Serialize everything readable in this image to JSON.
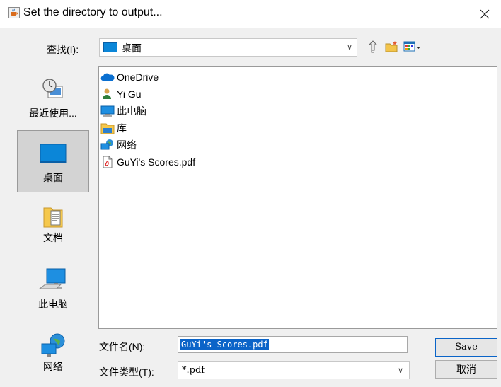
{
  "window": {
    "title": "Set the directory to output...",
    "title_icon": "java-cup-icon",
    "close_icon": "close-icon"
  },
  "lookin": {
    "label": "查找(I):",
    "value": "桌面",
    "value_icon": "desktop-icon",
    "toolbar": [
      "up-one-level-icon",
      "new-folder-icon",
      "view-menu-icon"
    ]
  },
  "sidebar": {
    "items": [
      {
        "label": "最近使用...",
        "icon": "recent-items-icon",
        "selected": false
      },
      {
        "label": "桌面",
        "icon": "desktop-icon",
        "selected": true
      },
      {
        "label": "文档",
        "icon": "documents-icon",
        "selected": false
      },
      {
        "label": "此电脑",
        "icon": "computer-icon",
        "selected": false
      },
      {
        "label": "网络",
        "icon": "network-icon",
        "selected": false
      }
    ]
  },
  "files": [
    {
      "name": "OneDrive",
      "icon": "onedrive-icon"
    },
    {
      "name": "Yi Gu",
      "icon": "user-icon"
    },
    {
      "name": "此电脑",
      "icon": "computer-icon"
    },
    {
      "name": "库",
      "icon": "library-icon"
    },
    {
      "name": "网络",
      "icon": "network-icon"
    },
    {
      "name": "GuYi's Scores.pdf",
      "icon": "pdf-file-icon"
    }
  ],
  "filename": {
    "label": "文件名(N):",
    "value": "GuYi's Scores.pdf"
  },
  "filetype": {
    "label": "文件类型(T):",
    "value": "*.pdf"
  },
  "buttons": {
    "save": "Save",
    "cancel": "取消"
  },
  "colors": {
    "accent": "#0b64c8",
    "selection_bg": "#d3d3d3",
    "dialog_bg": "#f0f0f0"
  }
}
